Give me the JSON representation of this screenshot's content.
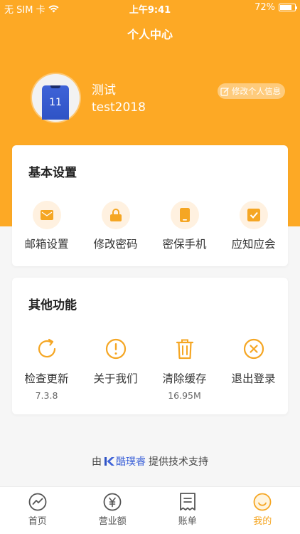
{
  "status_bar": {
    "carrier": "无 SIM 卡",
    "time": "上午9:41",
    "battery": "72%"
  },
  "nav": {
    "title": "个人中心"
  },
  "profile": {
    "avatar_text": "11",
    "name": "测试",
    "account": "test2018",
    "edit_label": "修改个人信息"
  },
  "basic_settings": {
    "title": "基本设置",
    "items": [
      {
        "label": "邮箱设置",
        "icon": "mail-icon"
      },
      {
        "label": "修改密码",
        "icon": "lock-icon"
      },
      {
        "label": "密保手机",
        "icon": "phone-icon"
      },
      {
        "label": "应知应会",
        "icon": "checkbox-icon"
      }
    ]
  },
  "other_functions": {
    "title": "其他功能",
    "items": [
      {
        "label": "检查更新",
        "sub": "7.3.8",
        "icon": "refresh-icon"
      },
      {
        "label": "关于我们",
        "sub": "",
        "icon": "info-icon"
      },
      {
        "label": "清除缓存",
        "sub": "16.95M",
        "icon": "trash-icon"
      },
      {
        "label": "退出登录",
        "sub": "",
        "icon": "logout-icon"
      }
    ]
  },
  "footer": {
    "prefix": "由",
    "brand": "酷璞睿",
    "suffix": "提供技术支持"
  },
  "tabs": [
    {
      "label": "首页",
      "icon": "chart-icon",
      "active": false
    },
    {
      "label": "营业额",
      "icon": "yen-icon",
      "active": false
    },
    {
      "label": "账单",
      "icon": "receipt-icon",
      "active": false
    },
    {
      "label": "我的",
      "icon": "smile-icon",
      "active": true
    }
  ],
  "colors": {
    "accent": "#fda925",
    "icon_orange": "#f5a623",
    "brand_blue": "#3e63d8"
  }
}
